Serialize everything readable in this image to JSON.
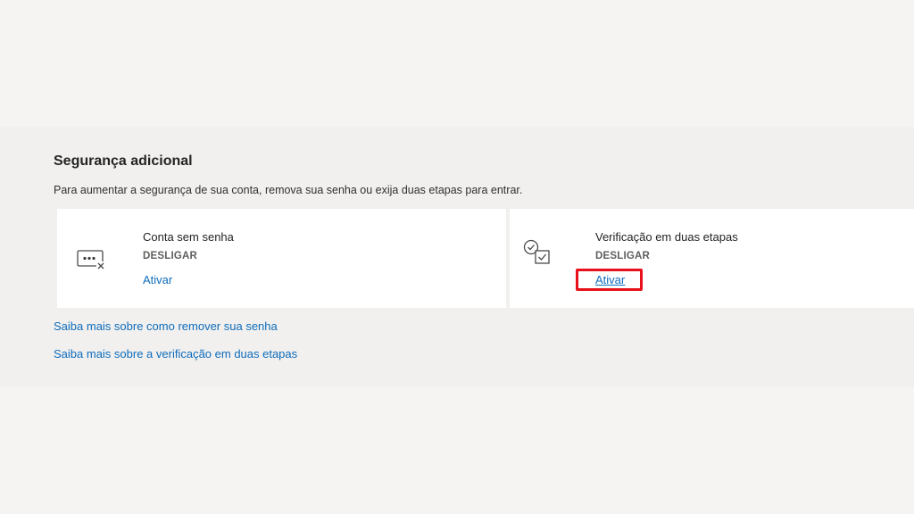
{
  "section": {
    "title": "Segurança adicional",
    "description": "Para aumentar a segurança de sua conta, remova sua senha ou exija duas etapas para entrar."
  },
  "cards": [
    {
      "icon": "password-removed-icon",
      "title": "Conta sem senha",
      "status": "DESLIGAR",
      "action": "Ativar"
    },
    {
      "icon": "two-step-verification-icon",
      "title": "Verificação em duas etapas",
      "status": "DESLIGAR",
      "action": "Ativar"
    }
  ],
  "links": {
    "remove_password": "Saiba mais sobre como remover sua senha",
    "two_step": "Saiba mais sobre a verificação em duas etapas"
  },
  "colors": {
    "accent": "#0f6cbd",
    "highlight": "#e8101b",
    "background": "#f5f4f3",
    "section_background": "#f1f0ee",
    "card_background": "#ffffff"
  }
}
